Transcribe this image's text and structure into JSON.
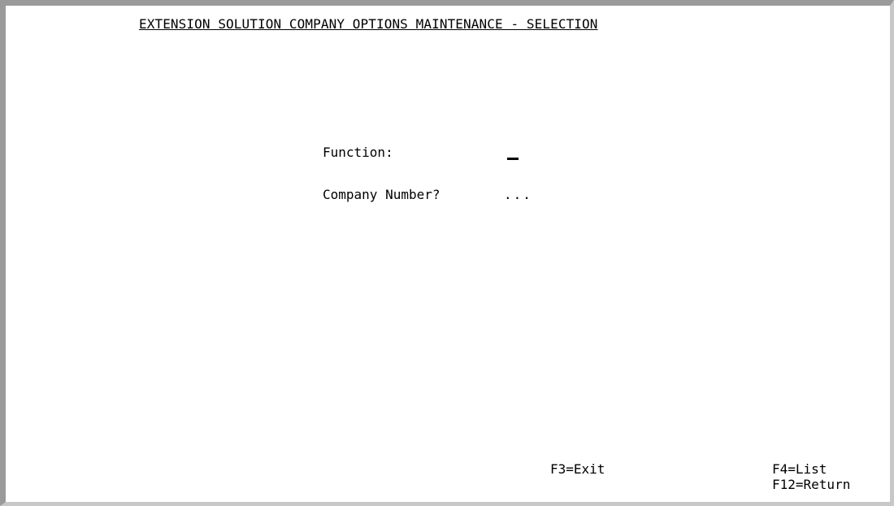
{
  "screen": {
    "title": "EXTENSION SOLUTION COMPANY OPTIONS MAINTENANCE - SELECTION"
  },
  "form": {
    "function_label": "Function:",
    "function_value": "",
    "company_label": "Company Number?",
    "company_value": "..."
  },
  "function_keys": {
    "exit": "F3=Exit",
    "list": "F4=List",
    "return": "F12=Return"
  }
}
